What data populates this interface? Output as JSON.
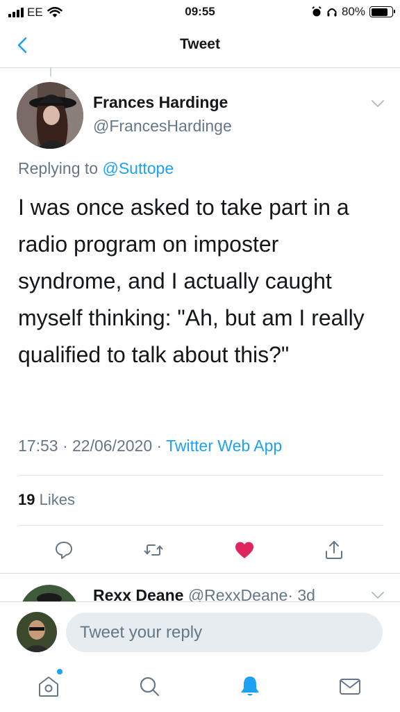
{
  "status_bar": {
    "carrier": "EE",
    "time": "09:55",
    "battery": "80%",
    "battery_level": 0.8
  },
  "header": {
    "back_icon": "chevron-left-icon",
    "title": "Tweet"
  },
  "tweet": {
    "author_name": "Frances Hardinge",
    "author_handle": "@FrancesHardinge",
    "replying_prefix": "Replying to",
    "replying_to": "@Suttope",
    "text": "I was once asked to take part in a radio program on imposter syndrome, and I actually caught myself thinking: \"Ah, but am I really qualified to talk about this?\"",
    "timestamp": "17:53 · 22/06/2020 ·",
    "source": "Twitter Web App",
    "likes_count": "19",
    "likes_label": "Likes",
    "actions": [
      "reply-icon",
      "retweet-icon",
      "like-icon",
      "share-icon"
    ],
    "like_color": "#e0245e"
  },
  "next_reply": {
    "author_name": "Rexx Deane",
    "author_handle": "@RexxDeane",
    "age": "· 3d"
  },
  "compose": {
    "placeholder": "Tweet your reply"
  },
  "tab_bar": {
    "items": [
      "home-icon",
      "search-icon",
      "notifications-icon",
      "messages-icon"
    ]
  },
  "colors": {
    "accent": "#1da1f2",
    "muted": "#657786",
    "text": "#14171a"
  }
}
